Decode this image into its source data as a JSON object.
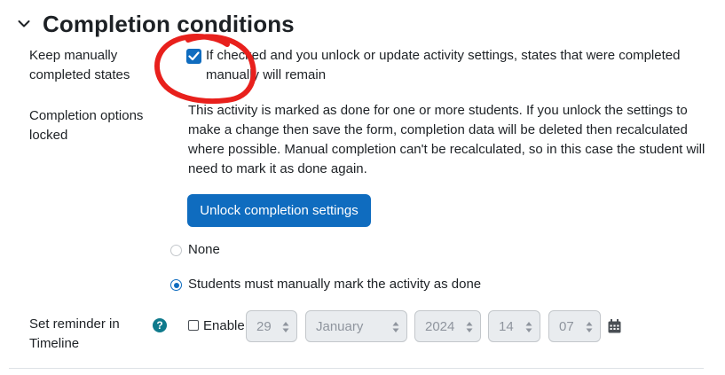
{
  "section": {
    "title": "Completion conditions"
  },
  "keep_manual": {
    "label_lines": [
      "Keep manually",
      "completed states"
    ],
    "checked": true,
    "description_lines": [
      "If checked and you unlock or update activity settings, states that were completed",
      "manually will remain"
    ]
  },
  "locked": {
    "label_lines": [
      "Completion options",
      "locked"
    ],
    "message_lines": [
      "This activity is marked as done for one or more students. If you unlock the settings to",
      "make a change then save the form, completion data will be deleted then recalculated",
      "where possible. Manual completion can't be recalculated, so in this case the student will",
      "need to mark it as done again."
    ],
    "unlock_button": "Unlock completion settings"
  },
  "completion_options": [
    {
      "label": "None",
      "selected": false
    },
    {
      "label": "Students must manually mark the activity as done",
      "selected": true
    }
  ],
  "reminder": {
    "label_lines": [
      "Set reminder in",
      "Timeline"
    ],
    "help_icon": "question-circle-icon",
    "enable_label": "Enable",
    "enabled": false,
    "day": "29",
    "month": "January",
    "year": "2024",
    "hour": "14",
    "minute": "07",
    "calendar_icon": "calendar-icon"
  },
  "colors": {
    "primary": "#0f6cbf",
    "help": "#0f7a8c",
    "text": "#1d2125",
    "disabled_bg": "#e9ecef",
    "annotation": "#e8201c"
  }
}
